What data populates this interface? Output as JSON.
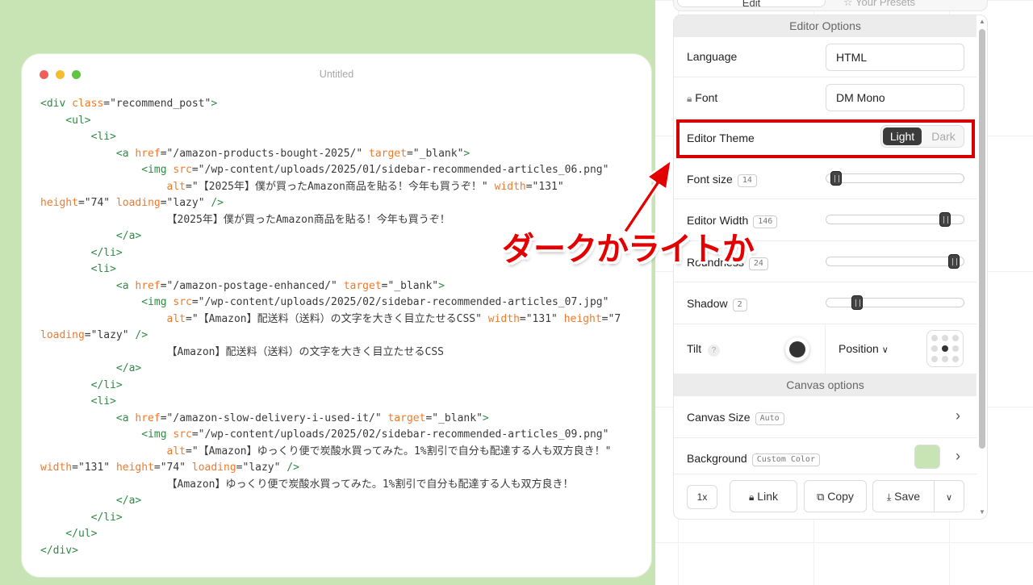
{
  "window": {
    "title": "Untitled",
    "traffic_colors": [
      "#ee5f57",
      "#f4bc2f",
      "#5fc43f"
    ]
  },
  "code_lines": [
    [
      [
        "t",
        "<div "
      ],
      [
        "a",
        "class"
      ],
      [
        "v",
        "=\"recommend_post\""
      ],
      [
        "t",
        ">"
      ]
    ],
    [
      [
        "t",
        "    <ul>"
      ]
    ],
    [
      [
        "t",
        "        <li>"
      ]
    ],
    [
      [
        "t",
        "            <a "
      ],
      [
        "a",
        "href"
      ],
      [
        "v",
        "=\"/amazon-products-bought-2025/\" "
      ],
      [
        "a",
        "target"
      ],
      [
        "v",
        "=\"_blank\""
      ],
      [
        "t",
        ">"
      ]
    ],
    [
      [
        "t",
        "                <img "
      ],
      [
        "a",
        "src"
      ],
      [
        "v",
        "=\"/wp-content/uploads/2025/01/sidebar-recommended-articles_06.png\""
      ]
    ],
    [
      [
        "a",
        "                    alt"
      ],
      [
        "v",
        "=\"【2025年】僕が買ったAmazon商品を貼る！今年も買うぞ！\" "
      ],
      [
        "a",
        "width"
      ],
      [
        "v",
        "=\"131\""
      ]
    ],
    [
      [
        "a",
        "height"
      ],
      [
        "v",
        "=\"74\" "
      ],
      [
        "a",
        "loading"
      ],
      [
        "v",
        "=\"lazy\" "
      ],
      [
        "t",
        "/>"
      ]
    ],
    [
      [
        "v",
        "                    【2025年】僕が買ったAmazon商品を貼る！今年も買うぞ！"
      ]
    ],
    [
      [
        "t",
        "            </a>"
      ]
    ],
    [
      [
        "t",
        "        </li>"
      ]
    ],
    [
      [
        "t",
        "        <li>"
      ]
    ],
    [
      [
        "t",
        "            <a "
      ],
      [
        "a",
        "href"
      ],
      [
        "v",
        "=\"/amazon-postage-enhanced/\" "
      ],
      [
        "a",
        "target"
      ],
      [
        "v",
        "=\"_blank\""
      ],
      [
        "t",
        ">"
      ]
    ],
    [
      [
        "t",
        "                <img "
      ],
      [
        "a",
        "src"
      ],
      [
        "v",
        "=\"/wp-content/uploads/2025/02/sidebar-recommended-articles_07.jpg\""
      ]
    ],
    [
      [
        "a",
        "                    alt"
      ],
      [
        "v",
        "=\"【Amazon】配送料（送料）の文字を大きく目立たせるCSS\" "
      ],
      [
        "a",
        "width"
      ],
      [
        "v",
        "=\"131\" "
      ],
      [
        "a",
        "height"
      ],
      [
        "v",
        "=\"7"
      ]
    ],
    [
      [
        "a",
        "loading"
      ],
      [
        "v",
        "=\"lazy\" "
      ],
      [
        "t",
        "/>"
      ]
    ],
    [
      [
        "v",
        "                    【Amazon】配送料（送料）の文字を大きく目立たせるCSS"
      ]
    ],
    [
      [
        "t",
        "            </a>"
      ]
    ],
    [
      [
        "t",
        "        </li>"
      ]
    ],
    [
      [
        "t",
        "        <li>"
      ]
    ],
    [
      [
        "t",
        "            <a "
      ],
      [
        "a",
        "href"
      ],
      [
        "v",
        "=\"/amazon-slow-delivery-i-used-it/\" "
      ],
      [
        "a",
        "target"
      ],
      [
        "v",
        "=\"_blank\""
      ],
      [
        "t",
        ">"
      ]
    ],
    [
      [
        "t",
        "                <img "
      ],
      [
        "a",
        "src"
      ],
      [
        "v",
        "=\"/wp-content/uploads/2025/02/sidebar-recommended-articles_09.png\""
      ]
    ],
    [
      [
        "a",
        "                    alt"
      ],
      [
        "v",
        "=\"【Amazon】ゆっくり便で炭酸水買ってみた。1%割引で自分も配達する人も双方良き！\""
      ]
    ],
    [
      [
        "a",
        "width"
      ],
      [
        "v",
        "=\"131\" "
      ],
      [
        "a",
        "height"
      ],
      [
        "v",
        "=\"74\" "
      ],
      [
        "a",
        "loading"
      ],
      [
        "v",
        "=\"lazy\" "
      ],
      [
        "t",
        "/>"
      ]
    ],
    [
      [
        "v",
        "                    【Amazon】ゆっくり便で炭酸水買ってみた。1%割引で自分も配達する人も双方良き！"
      ]
    ],
    [
      [
        "t",
        "            </a>"
      ]
    ],
    [
      [
        "t",
        "        </li>"
      ]
    ],
    [
      [
        "t",
        "    </ul>"
      ]
    ],
    [
      [
        "t",
        "</div>"
      ]
    ]
  ],
  "tabs": {
    "edit": "Edit",
    "presets": "Your Presets"
  },
  "editor_options": {
    "section_title": "Editor Options",
    "language": {
      "label": "Language",
      "value": "HTML"
    },
    "font": {
      "label": "Font",
      "value": "DM Mono"
    },
    "theme": {
      "label": "Editor Theme",
      "options": [
        "Light",
        "Dark"
      ],
      "selected": "Light"
    },
    "font_size": {
      "label": "Font size",
      "value": "14"
    },
    "editor_width": {
      "label": "Editor Width",
      "value": "146"
    },
    "roundness": {
      "label": "Roundness",
      "value": "24"
    },
    "shadow": {
      "label": "Shadow",
      "value": "2"
    },
    "tilt": {
      "label": "Tilt",
      "help": "?"
    },
    "position": {
      "label": "Position"
    }
  },
  "canvas_options": {
    "section_title": "Canvas options",
    "canvas_size": {
      "label": "Canvas Size",
      "value": "Auto"
    },
    "background": {
      "label": "Background",
      "value": "Custom Color",
      "color": "#c8e4b4"
    }
  },
  "actions": {
    "scale": "1x",
    "link": "Link",
    "copy": "Copy",
    "save": "Save"
  },
  "annotation": {
    "text": "ダークかライトか",
    "color": "#e30000"
  },
  "sliders": {
    "font_size": 0.03,
    "editor_width": 0.9,
    "roundness": 0.97,
    "shadow": 0.2
  }
}
